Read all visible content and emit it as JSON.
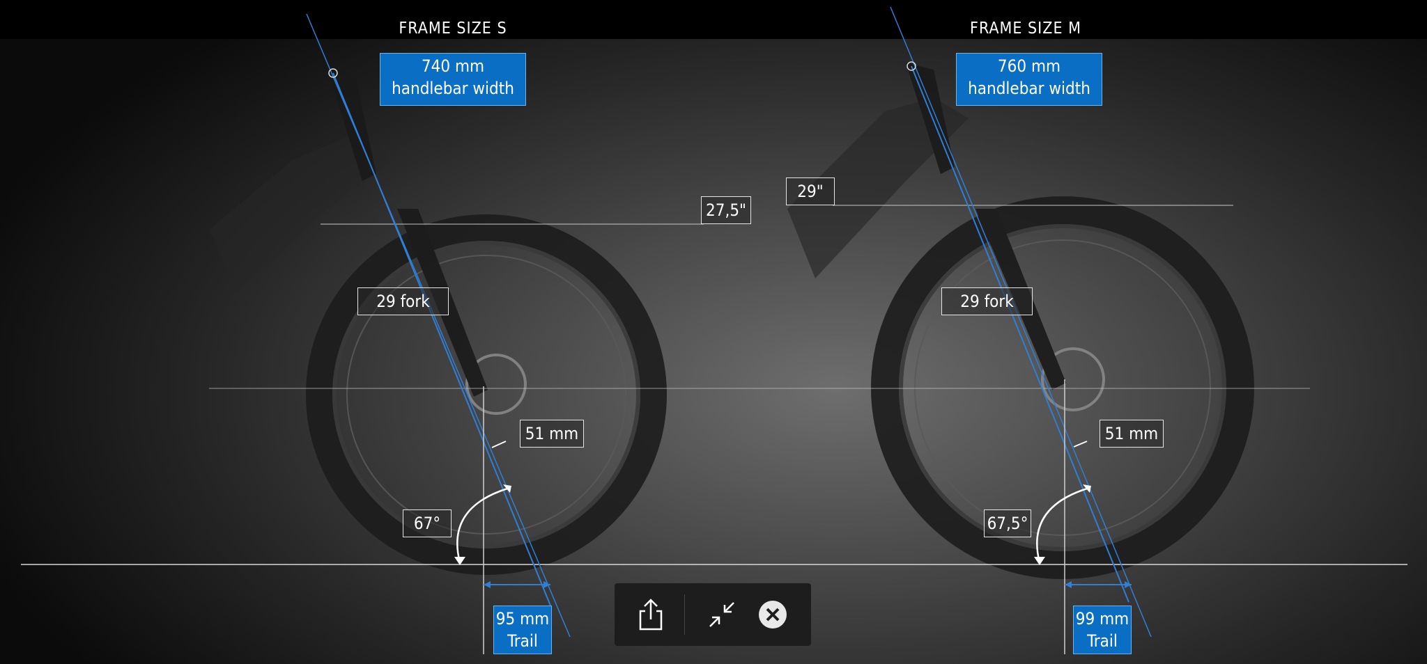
{
  "frames": [
    {
      "title": "FRAME SIZE S",
      "handlebar": {
        "value": "740 mm",
        "label": "handlebar width"
      },
      "wheel_size": "27,5\"",
      "fork": "29 fork",
      "offset": "51 mm",
      "head_angle": "67°",
      "trail": {
        "value": "95 mm",
        "label": "Trail"
      }
    },
    {
      "title": "FRAME SIZE M",
      "handlebar": {
        "value": "760 mm",
        "label": "handlebar width"
      },
      "wheel_size": "29\"",
      "fork": "29 fork",
      "offset": "51 mm",
      "head_angle": "67,5°",
      "trail": {
        "value": "99 mm",
        "label": "Trail"
      }
    }
  ],
  "toolbar": {
    "share_icon": "share-icon",
    "collapse_icon": "collapse-icon",
    "close_icon": "close-icon"
  },
  "colors": {
    "accent_blue": "#0a6fc4",
    "line_blue": "#2f7fd6",
    "background": "#000000"
  }
}
